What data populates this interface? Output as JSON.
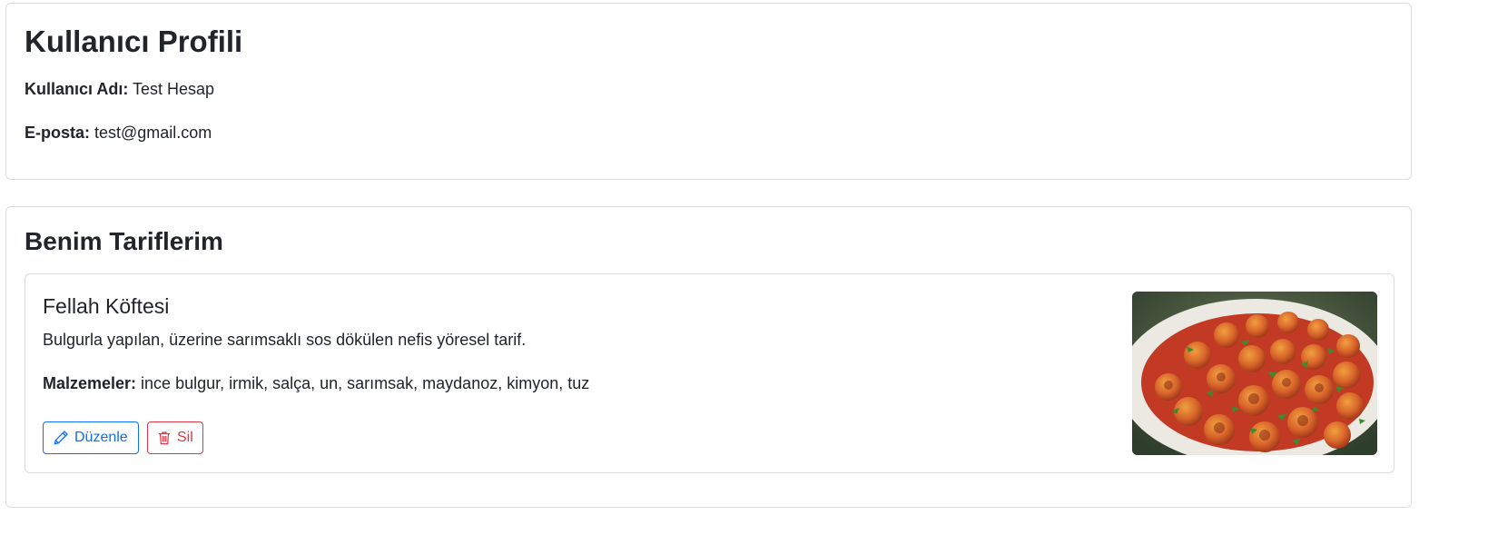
{
  "profile": {
    "title": "Kullanıcı Profili",
    "username_label": "Kullanıcı Adı:",
    "username_value": " Test Hesap",
    "email_label": "E-posta:",
    "email_value": " test@gmail.com"
  },
  "recipes": {
    "title": "Benim Tariflerim",
    "items": [
      {
        "name": "Fellah Köftesi",
        "description": "Bulgurla yapılan, üzerine sarımsaklı sos dökülen nefis yöresel tarif.",
        "ingredients_label": "Malzemeler:",
        "ingredients_value": " ince bulgur, irmik, salça, un, sarımsak, maydanoz, kimyon, tuz",
        "edit_label": "Düzenle",
        "delete_label": "Sil",
        "edit_icon": "pencil-icon",
        "delete_icon": "trash-icon"
      }
    ]
  },
  "colors": {
    "primary": "#0d6efd",
    "danger": "#dc3545",
    "border": "#dcdcdc",
    "text": "#212529"
  }
}
